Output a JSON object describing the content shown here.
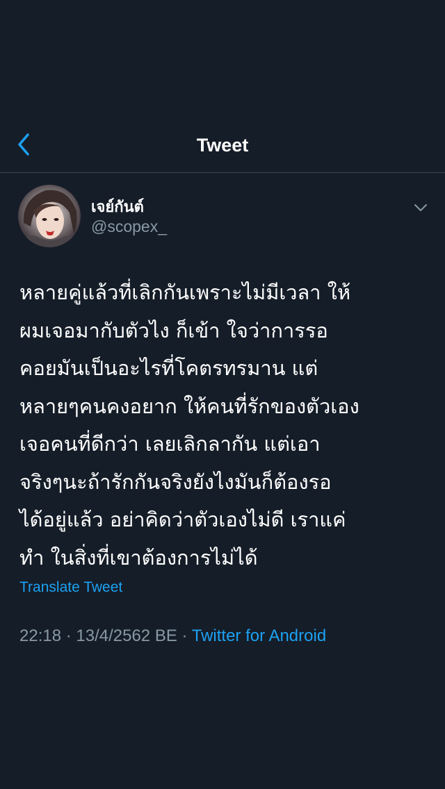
{
  "header": {
    "title": "Tweet",
    "back_icon": "chevron-left-icon",
    "accent_color": "#1da1f2"
  },
  "tweet": {
    "author": {
      "display_name": "เจย์กันต์",
      "handle": "@scopex_"
    },
    "menu_icon": "chevron-down-icon",
    "text_lines": [
      "หลายคู่แล้วที่เลิกกันเพราะไม่มีเวลา ให้",
      "ผมเจอมากับตัวไง ก็เข้า ใจว่าการรอ",
      "คอยมันเป็นอะไรที่โคตรทรมาน แต่",
      "หลายๆคนคงอยาก ให้คนที่รักของตัวเอง",
      "เจอคนที่ดีกว่า เลยเลิกลากัน แต่เอา",
      "จริงๆนะถ้ารักกันจริงยังไงมันก็ต้องรอ",
      "ได้อยู่แล้ว อย่าคิดว่าตัวเองไม่ดี เราแค่",
      "ทำ ในสิ่งที่เขาต้องการไม่ได้"
    ],
    "translate_label": "Translate Tweet",
    "timestamp": "22:18 · 13/4/2562 BE",
    "separator": " · ",
    "source": "Twitter for Android"
  },
  "colors": {
    "background": "#151d28",
    "text": "#ffffff",
    "secondary": "#8899a6",
    "link": "#1da1f2"
  }
}
